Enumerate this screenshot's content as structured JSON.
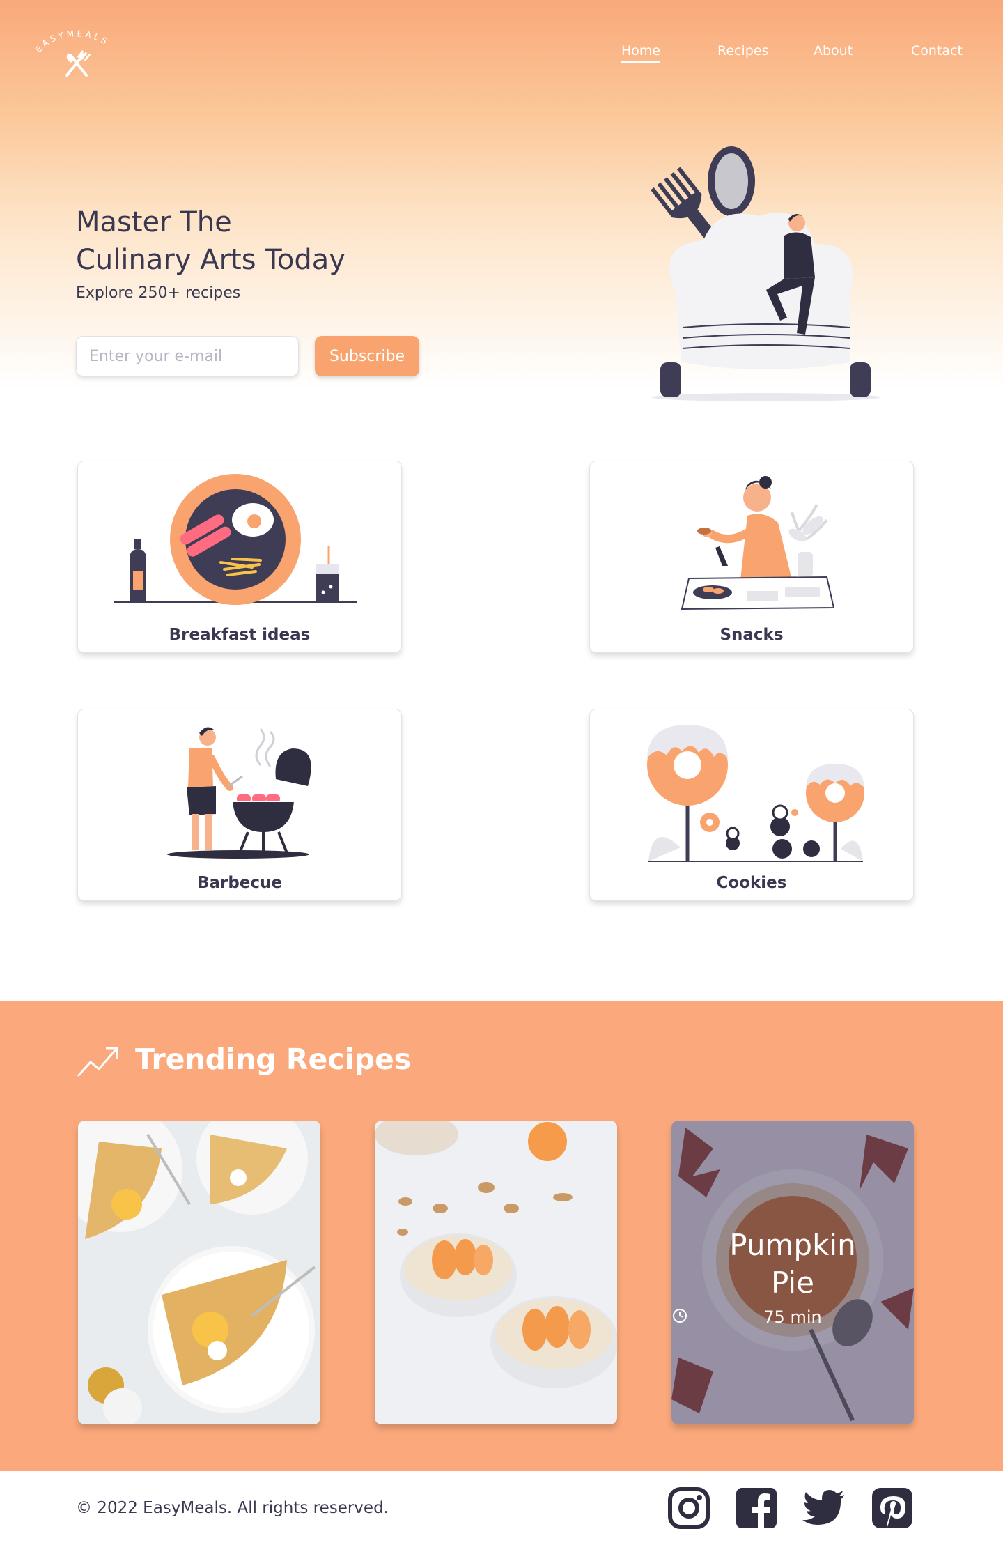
{
  "brand": {
    "name": "EASYMEALS"
  },
  "nav": {
    "items": [
      {
        "label": "Home",
        "active": true
      },
      {
        "label": "Recipes",
        "active": false
      },
      {
        "label": "About",
        "active": false
      },
      {
        "label": "Contact",
        "active": false
      }
    ]
  },
  "hero": {
    "title_line1": "Master The",
    "title_line2": "Culinary Arts Today",
    "subtitle": "Explore 250+ recipes",
    "email_placeholder": "Enter your e-mail",
    "subscribe_label": "Subscribe"
  },
  "categories": [
    {
      "label": "Breakfast ideas",
      "icon": "breakfast-illustration"
    },
    {
      "label": "Snacks",
      "icon": "snacks-illustration"
    },
    {
      "label": "Barbecue",
      "icon": "barbecue-illustration"
    },
    {
      "label": "Cookies",
      "icon": "cookies-illustration"
    }
  ],
  "trending": {
    "title": "Trending Recipes",
    "icon": "trending-up-icon",
    "recipes": [
      {
        "name": "",
        "time": "",
        "image": "crepes-photo"
      },
      {
        "name": "",
        "time": "",
        "image": "yogurt-bowls-photo"
      },
      {
        "name_line1": "Pumpkin",
        "name_line2": "Pie",
        "time": "75 min",
        "image": "pumpkin-pie-photo"
      }
    ]
  },
  "footer": {
    "copyright": "© 2022 EasyMeals. All rights reserved.",
    "social": [
      "instagram-icon",
      "facebook-icon",
      "twitter-icon",
      "pinterest-icon"
    ]
  },
  "colors": {
    "accent": "#fba97c",
    "button": "#f9a46f",
    "text": "#3a3850",
    "white": "#ffffff"
  }
}
